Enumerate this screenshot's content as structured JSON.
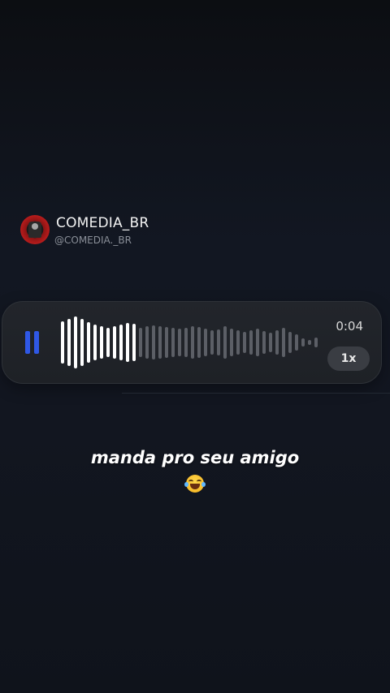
{
  "profile": {
    "name": "COMEDIA_BR",
    "handle": "@COMEDIA._BR"
  },
  "player": {
    "time": "0:04",
    "speed": "1x",
    "progress": 0.31
  },
  "caption": {
    "text": "manda pro seu amigo",
    "emoji_icon": "face-with-tears-of-joy-icon"
  },
  "colors": {
    "accent": "#2f58e6",
    "played": "#ffffff",
    "unplayed": "#5c5f66"
  }
}
